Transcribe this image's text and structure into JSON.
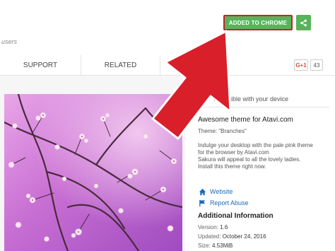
{
  "header": {
    "users_text": "users",
    "add_button_label": "ADDED TO CHROME",
    "share_icon": "share-icon"
  },
  "tabs": [
    {
      "label": "SUPPORT"
    },
    {
      "label": "RELATED"
    }
  ],
  "social": {
    "gplus_label": "G+1",
    "gplus_count": "43"
  },
  "details": {
    "compat_text": "ompatible with your device",
    "title": "Awesome theme for Atavi.com",
    "theme_line": "Theme: \"Branches\"",
    "description": [
      "Indulge your desktop with the pale pink theme",
      "for the browser by Atavi.com",
      "Sakura will appeal to all the lovely ladies.",
      "Install this theme right now."
    ],
    "links": [
      {
        "label": "Website",
        "icon": "home-icon"
      },
      {
        "label": "Report Abuse",
        "icon": "flag-icon"
      }
    ],
    "additional_info": {
      "heading": "Additional Information",
      "version_label": "Version:",
      "version": "1.6",
      "updated_label": "Updated:",
      "updated": "October 24, 2016",
      "size_label": "Size:",
      "size": "4.53MiB"
    }
  },
  "colors": {
    "accent_green": "#58b45a",
    "highlight_red": "#cc1f2c",
    "arrow_red": "#d81f2a",
    "link_blue": "#1a6bb8"
  }
}
